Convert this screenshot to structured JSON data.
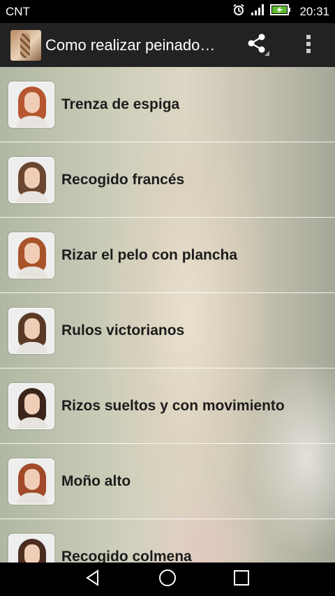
{
  "status_bar": {
    "carrier": "CNT",
    "time": "20:31",
    "icons": [
      "alarm-icon",
      "signal-icon",
      "battery-charging-icon"
    ]
  },
  "action_bar": {
    "title": "Como realizar peinado…",
    "icons": {
      "app": "braid-hairstyle-app-icon",
      "share": "share-icon",
      "overflow": "overflow-menu-icon"
    }
  },
  "list": {
    "items": [
      {
        "label": "Trenza de espiga",
        "hair_color": "#b5562f"
      },
      {
        "label": "Recogido francés",
        "hair_color": "#6b4630"
      },
      {
        "label": "Rizar el pelo con plancha",
        "hair_color": "#a8532a"
      },
      {
        "label": "Rulos victorianos",
        "hair_color": "#5a3a26"
      },
      {
        "label": "Rizos sueltos y con movimiento",
        "hair_color": "#3b2418"
      },
      {
        "label": "Moño alto",
        "hair_color": "#a24a2a"
      },
      {
        "label": "Recogido colmena",
        "hair_color": "#4a2f20"
      }
    ]
  },
  "nav_bar": {
    "icons": [
      "back-icon",
      "home-icon",
      "recents-icon"
    ]
  }
}
